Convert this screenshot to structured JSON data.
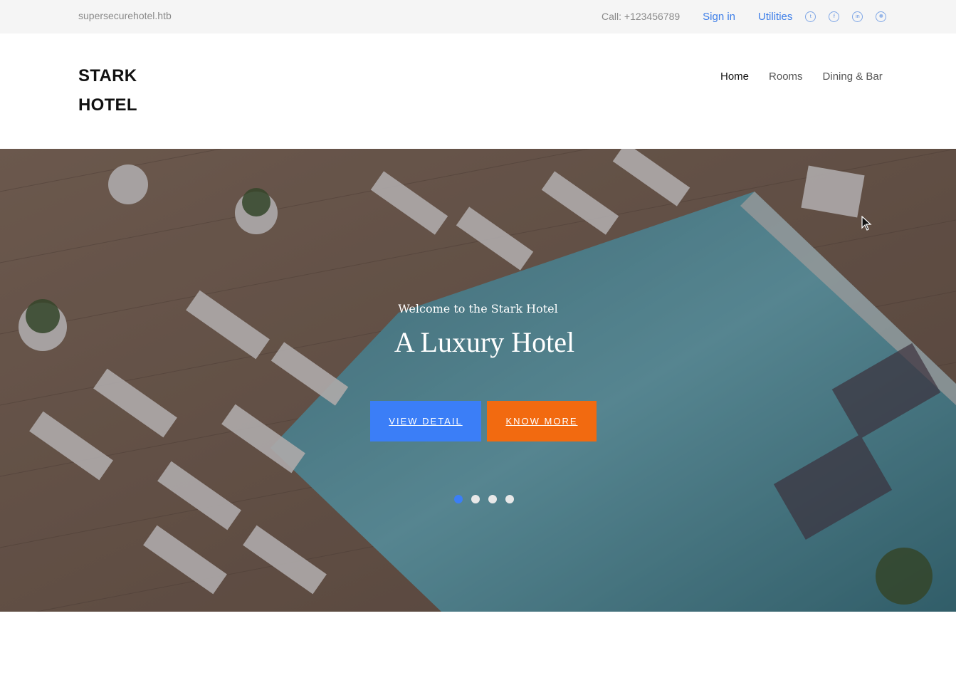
{
  "topbar": {
    "domain": "supersecurehotel.htb",
    "phone": "Call: +123456789",
    "signin": "Sign in",
    "utilities": "Utilities",
    "social_icons": [
      "twitter-icon",
      "facebook-icon",
      "linkedin-icon",
      "dribbble-icon"
    ]
  },
  "header": {
    "logo_line1": "STARK",
    "logo_line2": "HOTEL",
    "nav": [
      "Home",
      "Rooms",
      "Dining & Bar"
    ]
  },
  "hero": {
    "subtitle": "Welcome to the Stark Hotel",
    "title": "A Luxury Hotel",
    "btn_view": "View Detail",
    "btn_know": "Know More",
    "active_slide": 1,
    "slides_total": 4
  },
  "colors": {
    "accent_blue": "#3b7ef7",
    "accent_orange": "#f26a10",
    "link_blue": "#3d7ee8"
  }
}
